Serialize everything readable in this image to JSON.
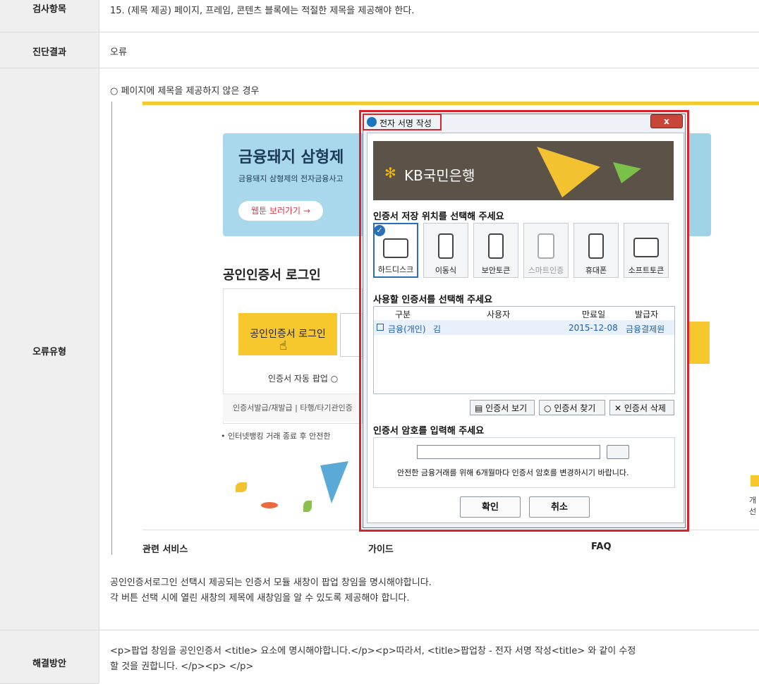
{
  "rows": {
    "item": {
      "label": "검사항목",
      "text": "15. (제목 제공) 페이지, 프레임, 콘텐츠 블록에는 적절한 제목을 제공해야 한다."
    },
    "result": {
      "label": "진단결과",
      "text": "오류"
    },
    "type": {
      "label": "오류유형",
      "intro": "○ 페이지에 제목을 제공하지 않은 경우",
      "desc1": "공인인증서로그인 선택시 제공되는 인증서 모듈 새창이 팝업 창임을 명시해야합니다.",
      "desc2": "각 버튼 선택 시에 열린 새창의 제목에 새창임을 알 수 있도록 제공해야 합니다."
    },
    "fix": {
      "label": "해결방안",
      "line1": "<p>팝업 창임을 공인인증서 <title> 요소에 명시해야합니다.</p><p>따라서, <title>팝업창 - 전자 서명 작성<title> 와 같이 수정",
      "line2": "할 것을 권합니다.   </p><p> </p>"
    }
  },
  "screenshot": {
    "banner_title": "금융돼지 삼형제",
    "banner_sub": "금융돼지 삼형제의 전자금융사고",
    "banner_btn": "웹툰 보러가기 →",
    "login_title": "공인인증서 로그인",
    "login_btn": "공인인증서 로그인",
    "auto_popup": "인증서 자동 팝업  ○",
    "bottom_links": "인증서발급/재발급 | 타행/타기관인증",
    "notice": "• 인터넷뱅킹 거래 종료 후 안전한",
    "footer1": "관련 서비스",
    "footer2": "가이드",
    "footer3": "FAQ",
    "right_text": "개선"
  },
  "dialog": {
    "title": "전자 서명 작성",
    "close": "x",
    "bank_name": "KB국민은행",
    "storage_title": "인증서 저장 위치를 선택해 주세요",
    "storage": [
      "하드디스크",
      "이동식",
      "보안토큰",
      "스마트인증",
      "휴대폰",
      "소프트토큰"
    ],
    "cert_title": "사용할 인증서를 선택해 주세요",
    "columns": [
      "구분",
      "사용자",
      "만료일",
      "발급자"
    ],
    "cert_row": {
      "type": "금융(개인)",
      "user": "김",
      "expiry": "2015-12-08",
      "issuer": "금융결제원"
    },
    "btn_view": "인증서 보기",
    "btn_find": "인증서 찾기",
    "btn_delete": "인증서 삭제",
    "pw_title": "인증서 암호를 입력해 주세요",
    "pw_note": "안전한 금융거래를 위해 6개월마다 인증서 암호를 변경하시기 바랍니다.",
    "ok": "확인",
    "cancel": "취소"
  },
  "colors": {
    "highlight": "#d8232a",
    "header_bg": "#efefef",
    "kb_yellow": "#f6b600",
    "link_blue": "#1e5fae"
  }
}
